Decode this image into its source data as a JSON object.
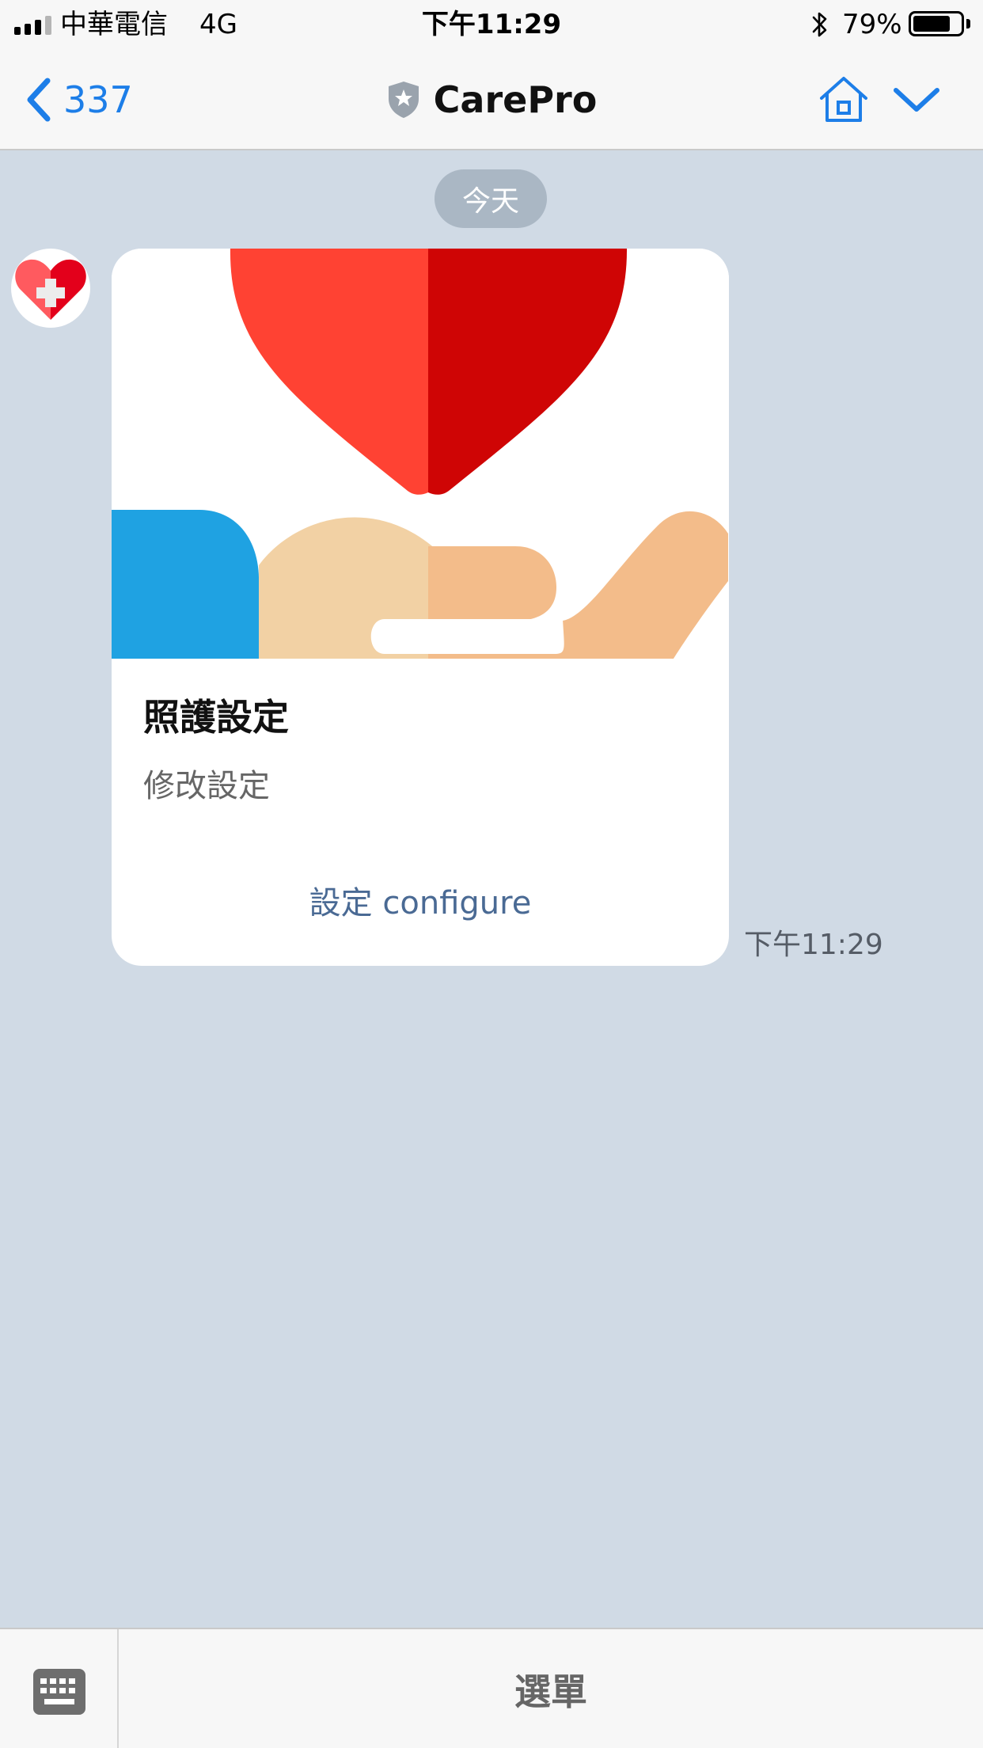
{
  "status_bar": {
    "carrier": "中華電信",
    "network": "4G",
    "time": "下午11:29",
    "battery_percent": "79%",
    "battery_level": 0.79
  },
  "nav": {
    "back_count": "337",
    "title": "CarePro"
  },
  "chat": {
    "date_label": "今天",
    "message": {
      "card_title": "照護設定",
      "card_subtitle": "修改設定",
      "card_action": "設定 configure",
      "time": "下午11:29"
    }
  },
  "bottom_bar": {
    "menu_label": "選單"
  },
  "colors": {
    "accent": "#1d7ee8",
    "chat_background": "#d0dae5",
    "action_text": "#4a6a94",
    "heart_left": "#ff4233",
    "heart_right": "#cf0505",
    "sleeve": "#1fa2e2",
    "hand_light": "#f2d1a4",
    "hand_dark": "#f3bc8a"
  },
  "icons": {
    "back": "chevron-left-icon",
    "shield": "shield-star-icon",
    "home": "home-icon",
    "expand": "chevron-down-icon",
    "keyboard": "keyboard-icon",
    "avatar": "heart-medical-cross-icon"
  }
}
